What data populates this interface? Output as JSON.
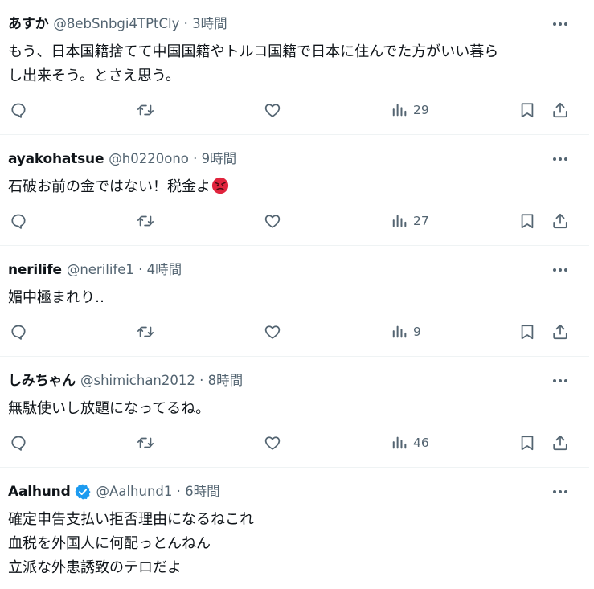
{
  "tweets": [
    {
      "name": "あすか",
      "meta": "@8ebSnbgi4TPtCly · 3時間",
      "verified": false,
      "lines": [
        "もう、日本国籍捨てて中国国籍やトルコ国籍で日本に住んでた方がいい暮ら",
        "し出来そう。とさえ思う。"
      ],
      "views": "29"
    },
    {
      "name": "ayakohatsue",
      "meta": "@h0220ono · 9時間",
      "verified": false,
      "lines": [
        "石破お前の金ではない！税金よ"
      ],
      "emoji": "angry-face",
      "views": "27"
    },
    {
      "name": "nerilife",
      "meta": "@nerilife1 · 4時間",
      "verified": false,
      "lines": [
        "媚中極まれり‥"
      ],
      "views": "9"
    },
    {
      "name": "しみちゃん",
      "meta": "@shimichan2012 · 8時間",
      "verified": false,
      "lines": [
        "無駄使いし放題になってるね。"
      ],
      "views": "46"
    },
    {
      "name": "Aalhund",
      "meta": "@Aalhund1 · 6時間",
      "verified": true,
      "lines": [
        "確定申告支払い拒否理由になるねこれ",
        "血税を外国人に何配っとんねん",
        "立派な外患誘致のテロだよ"
      ]
    }
  ],
  "colors": {
    "text": "#0f1419",
    "secondary": "#536471",
    "divider": "#eff3f4",
    "verified": "#1d9bf0",
    "angry_emoji": "#e0243d"
  }
}
